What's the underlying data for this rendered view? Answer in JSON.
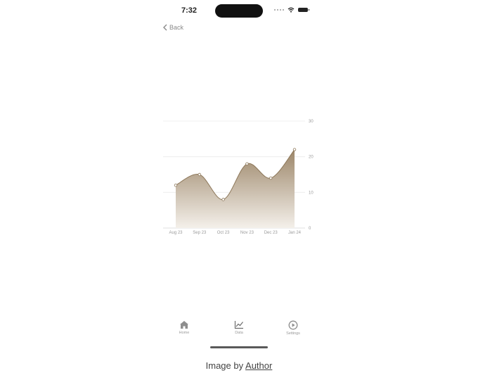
{
  "status_bar": {
    "time": "7:32"
  },
  "nav": {
    "back_label": "Back"
  },
  "chart_data": {
    "type": "area",
    "categories": [
      "Aug 23",
      "Sep 23",
      "Oct 23",
      "Nov 23",
      "Dec 23",
      "Jan 24"
    ],
    "x": [
      "Aug 23",
      "Sep 23",
      "Oct 23",
      "Nov 23",
      "Dec 23",
      "Jan 24"
    ],
    "values": [
      12,
      15,
      8,
      18,
      14,
      22
    ],
    "ylim": [
      0,
      30
    ],
    "yticks": [
      0,
      10,
      20,
      30
    ],
    "grid": true,
    "y_axis_side": "right",
    "fill_color_top": "#9c8669",
    "fill_color_bottom": "#f4f0ea",
    "line_color": "#8c7658"
  },
  "tabs": [
    {
      "label": "Home",
      "icon": "house-icon"
    },
    {
      "label": "Data",
      "icon": "chart-icon"
    },
    {
      "label": "Settings",
      "icon": "play-circle-icon"
    }
  ],
  "caption": {
    "prefix": "Image by",
    "link": "Author"
  }
}
